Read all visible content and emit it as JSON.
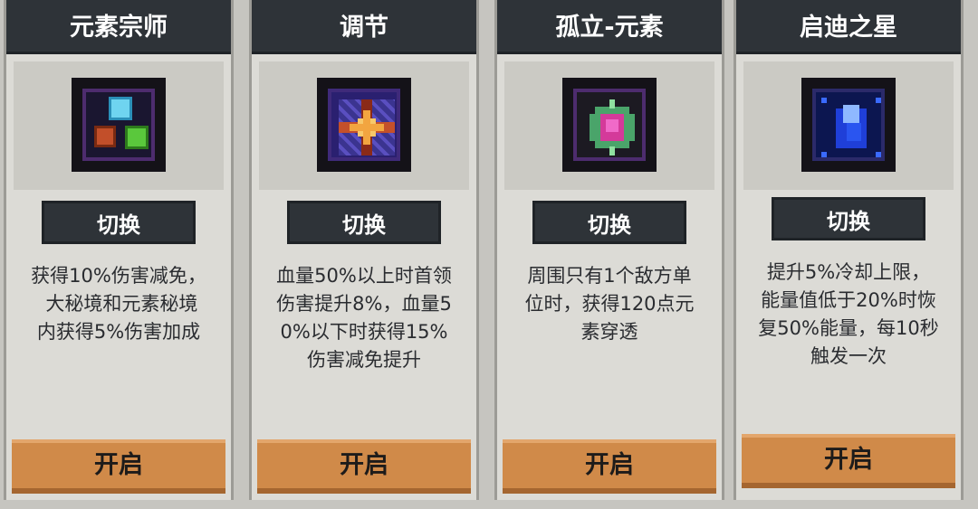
{
  "cards": [
    {
      "title": "元素宗师",
      "icon": "element-master-orbs-icon",
      "switch_label": "切换",
      "description": "获得10%伤害减免，\n 大秘境和元素秘境\n内获得5%伤害加成",
      "open_label": "开启"
    },
    {
      "title": "调节",
      "icon": "adjust-star-icon",
      "switch_label": "切换",
      "description": "血量50%以上时首领\n伤害提升8%，血量5\n0%以下时获得15%\n伤害减免提升",
      "open_label": "开启"
    },
    {
      "title": "孤立-元素",
      "icon": "isolated-element-gem-icon",
      "switch_label": "切换",
      "description": "周围只有1个敌方单\n位时，获得120点元\n素穿透",
      "open_label": "开启"
    },
    {
      "title": "启迪之星",
      "icon": "enlightenment-star-crystal-icon",
      "switch_label": "切换",
      "description": "提升5%冷却上限，\n能量值低于20%时恢\n复50%能量，每10秒\n触发一次",
      "open_label": "开启"
    }
  ],
  "colors": {
    "header_bg": "#2e3338",
    "card_bg": "#dcdbd6",
    "open_button": "#d08a49",
    "text": "#2a2c30"
  }
}
